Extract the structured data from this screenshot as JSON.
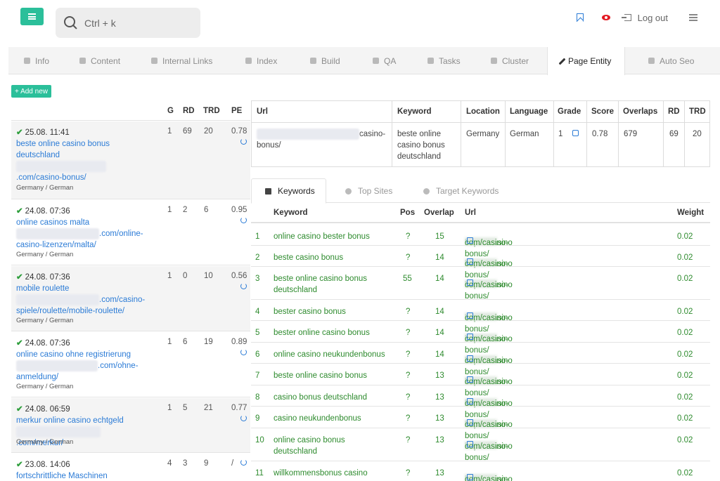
{
  "header": {
    "search_placeholder": "Ctrl + k",
    "logout_label": "Log out"
  },
  "tabs": [
    {
      "label": "Info",
      "icon": "info-icon"
    },
    {
      "label": "Content",
      "icon": "file-icon"
    },
    {
      "label": "Internal Links",
      "icon": "link-icon"
    },
    {
      "label": "Index",
      "icon": "list-icon"
    },
    {
      "label": "Build",
      "icon": "hammer-icon"
    },
    {
      "label": "QA",
      "icon": "list-icon"
    },
    {
      "label": "Tasks",
      "icon": "tasks-icon"
    },
    {
      "label": "Cluster",
      "icon": "cluster-icon"
    },
    {
      "label": "Page Entity",
      "icon": "pencil-icon",
      "active": true
    },
    {
      "label": "Auto Seo",
      "icon": "auto-icon"
    }
  ],
  "add_new_label": "+ Add new",
  "left_table": {
    "headers": {
      "g": "G",
      "rd": "RD",
      "trd": "TRD",
      "pe": "PE"
    },
    "rows": [
      {
        "date": "25.08. 11:41",
        "keyword": "beste online casino bonus deutschland",
        "url_tail": ".com/casino-bonus/",
        "location": "Germany / German",
        "g": "1",
        "rd": "69",
        "trd": "20",
        "pe": "0.78"
      },
      {
        "date": "24.08. 07:36",
        "keyword": "online casinos malta",
        "url_tail": ".com/online-casino-lizenzen/malta/",
        "location": "Germany / German",
        "g": "1",
        "rd": "2",
        "trd": "6",
        "pe": "0.95"
      },
      {
        "date": "24.08. 07:36",
        "keyword": "mobile roulette",
        "url_tail": ".com/casino-spiele/roulette/mobile-roulette/",
        "location": "Germany / German",
        "g": "1",
        "rd": "0",
        "trd": "10",
        "pe": "0.56"
      },
      {
        "date": "24.08. 07:36",
        "keyword": "online casino ohne registrierung",
        "url_tail": ".com/ohne-anmeldung/",
        "location": "Germany / German",
        "g": "1",
        "rd": "6",
        "trd": "19",
        "pe": "0.89"
      },
      {
        "date": "24.08. 06:59",
        "keyword": "merkur online casino echtgeld",
        "url_tail": ".com/merkur/",
        "location": "Germany / German",
        "g": "1",
        "rd": "5",
        "trd": "21",
        "pe": "0.77"
      },
      {
        "date": "23.08. 14:06",
        "keyword": "fortschrittliche Maschinen",
        "url_tail": "",
        "location": "",
        "g": "4",
        "rd": "3",
        "trd": "9",
        "pe": "/"
      }
    ]
  },
  "entity": {
    "headers": {
      "url": "Url",
      "keyword": "Keyword",
      "location": "Location",
      "language": "Language",
      "grade": "Grade",
      "score": "Score",
      "overlaps": "Overlaps",
      "rd": "RD",
      "trd": "TRD"
    },
    "row": {
      "url_tail": "casino-bonus/",
      "keyword": "beste online casino bonus deutschland",
      "location": "Germany",
      "language": "German",
      "grade": "1",
      "score": "0.78",
      "overlaps": "679",
      "rd": "69",
      "trd": "20"
    }
  },
  "subtabs": [
    {
      "label": "Keywords",
      "active": true,
      "icon": "list-icon"
    },
    {
      "label": "Top Sites",
      "icon": "trophy-icon"
    },
    {
      "label": "Target Keywords",
      "icon": "target-icon"
    }
  ],
  "keywords": {
    "headers": {
      "keyword": "Keyword",
      "pos": "Pos",
      "overlap": "Overlap",
      "url": "Url",
      "weight": "Weight"
    },
    "url_prefix": "https://casino",
    "url_suffix": "com/casino-bonus/",
    "rows": [
      {
        "n": "1",
        "keyword": "online casino bester bonus",
        "pos": "?",
        "overlap": "15",
        "weight": "0.02"
      },
      {
        "n": "2",
        "keyword": "beste casino bonus",
        "pos": "?",
        "overlap": "14",
        "weight": "0.02"
      },
      {
        "n": "3",
        "keyword": "beste online casino bonus deutschland",
        "pos": "55",
        "overlap": "14",
        "weight": "0.02"
      },
      {
        "n": "4",
        "keyword": "bester casino bonus",
        "pos": "?",
        "overlap": "14",
        "weight": "0.02"
      },
      {
        "n": "5",
        "keyword": "bester online casino bonus",
        "pos": "?",
        "overlap": "14",
        "weight": "0.02"
      },
      {
        "n": "6",
        "keyword": "online casino neukundenbonus",
        "pos": "?",
        "overlap": "14",
        "weight": "0.02"
      },
      {
        "n": "7",
        "keyword": "beste online casino bonus",
        "pos": "?",
        "overlap": "13",
        "weight": "0.02"
      },
      {
        "n": "8",
        "keyword": "casino bonus deutschland",
        "pos": "?",
        "overlap": "13",
        "weight": "0.02"
      },
      {
        "n": "9",
        "keyword": "casino neukundenbonus",
        "pos": "?",
        "overlap": "13",
        "weight": "0.02"
      },
      {
        "n": "10",
        "keyword": "online casino bonus deutschland",
        "pos": "?",
        "overlap": "13",
        "weight": "0.02"
      },
      {
        "n": "11",
        "keyword": "willkommensbonus casino",
        "pos": "?",
        "overlap": "13",
        "weight": "0.02"
      }
    ]
  }
}
